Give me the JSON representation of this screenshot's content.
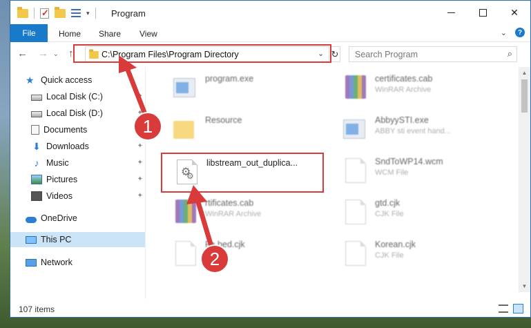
{
  "window": {
    "title": "Program",
    "controls": {
      "minimize": "—",
      "maximize": "☐",
      "close": "✕"
    }
  },
  "ribbon": {
    "tabs": [
      "File",
      "Home",
      "Share",
      "View"
    ],
    "help": "?"
  },
  "nav": {
    "back": "←",
    "forward": "→",
    "up": "↑",
    "address": "C:\\Program Files\\Program Directory",
    "search_placeholder": "Search Program"
  },
  "sidebar": {
    "items": [
      {
        "label": "Quick access",
        "icon": "star-icon"
      },
      {
        "label": "Local Disk (C:)",
        "icon": "disk-icon",
        "pinned": true
      },
      {
        "label": "Local Disk (D:)",
        "icon": "disk-icon",
        "pinned": true
      },
      {
        "label": "Documents",
        "icon": "documents-icon",
        "pinned": true
      },
      {
        "label": "Downloads",
        "icon": "downloads-icon",
        "pinned": true
      },
      {
        "label": "Music",
        "icon": "music-icon",
        "pinned": true
      },
      {
        "label": "Pictures",
        "icon": "pictures-icon",
        "pinned": true
      },
      {
        "label": "Videos",
        "icon": "videos-icon",
        "pinned": true
      },
      {
        "label": "OneDrive",
        "icon": "onedrive-icon"
      },
      {
        "label": "This PC",
        "icon": "pc-icon",
        "selected": true
      },
      {
        "label": "Network",
        "icon": "network-icon"
      }
    ]
  },
  "files": [
    {
      "name": "program.exe",
      "type": "",
      "icon": "exe-icon"
    },
    {
      "name": "certificates.cab",
      "type": "WinRAR Archive",
      "icon": "rar-icon"
    },
    {
      "name": "Resource",
      "type": "",
      "icon": "folder-icon"
    },
    {
      "name": "AbbyySTI.exe",
      "type": "ABBY sti event hand...",
      "icon": "exe-icon"
    },
    {
      "name": "libstream_out_duplica...",
      "type": "",
      "icon": "settings-file-icon"
    },
    {
      "name": "SndToWP14.wcm",
      "type": "WCM File",
      "icon": "page-icon"
    },
    {
      "name": "rtificates.cab",
      "type": "WinRAR Archive",
      "icon": "rar-icon"
    },
    {
      "name": "gtd.cjk",
      "type": "CJK File",
      "icon": "page-icon"
    },
    {
      "name": "Fa   bed.cjk",
      "type": "",
      "icon": "page-icon"
    },
    {
      "name": "Korean.cjk",
      "type": "CJK File",
      "icon": "page-icon"
    }
  ],
  "status": {
    "item_count": "107 items"
  },
  "callouts": [
    "1",
    "2"
  ],
  "colors": {
    "accent": "#1979ca",
    "highlight": "#d93a3a",
    "selected": "#cce4f7"
  }
}
